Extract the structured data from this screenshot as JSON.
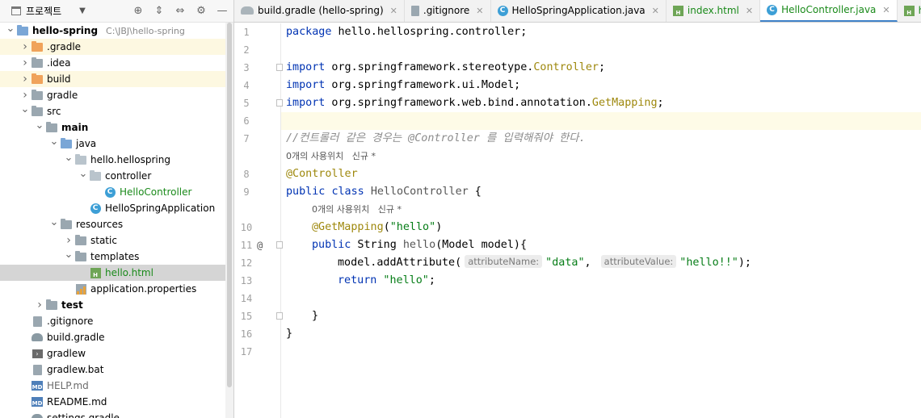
{
  "panel": {
    "title": "프로젝트",
    "tools": [
      "target-icon",
      "expand-all-icon",
      "collapse-all-icon",
      "gear-icon",
      "minimize-icon"
    ]
  },
  "tree": [
    {
      "depth": 0,
      "arrow": "down",
      "icon": "module-folder",
      "label": "hello-spring",
      "bold": true,
      "path": "C:\\JBJ\\hello-spring"
    },
    {
      "depth": 1,
      "arrow": "right",
      "icon": "folder-orange",
      "label": ".gradle",
      "hl": true
    },
    {
      "depth": 1,
      "arrow": "right",
      "icon": "folder",
      "label": ".idea"
    },
    {
      "depth": 1,
      "arrow": "right",
      "icon": "folder-orange",
      "label": "build",
      "hl": true
    },
    {
      "depth": 1,
      "arrow": "right",
      "icon": "folder",
      "label": "gradle"
    },
    {
      "depth": 1,
      "arrow": "down",
      "icon": "folder",
      "label": "src"
    },
    {
      "depth": 2,
      "arrow": "down",
      "icon": "folder",
      "label": "main",
      "bold": true
    },
    {
      "depth": 3,
      "arrow": "down",
      "icon": "folder-blue",
      "label": "java"
    },
    {
      "depth": 4,
      "arrow": "down",
      "icon": "folder-pkg",
      "label": "hello.hellospring"
    },
    {
      "depth": 5,
      "arrow": "down",
      "icon": "folder-pkg",
      "label": "controller"
    },
    {
      "depth": 6,
      "arrow": "",
      "icon": "class",
      "label": "HelloController",
      "green": true
    },
    {
      "depth": 5,
      "arrow": "",
      "icon": "class",
      "label": "HelloSpringApplication"
    },
    {
      "depth": 3,
      "arrow": "down",
      "icon": "folder-res",
      "label": "resources"
    },
    {
      "depth": 4,
      "arrow": "right",
      "icon": "folder",
      "label": "static"
    },
    {
      "depth": 4,
      "arrow": "down",
      "icon": "folder",
      "label": "templates"
    },
    {
      "depth": 5,
      "arrow": "",
      "icon": "html",
      "label": "hello.html",
      "green": true,
      "selected": true
    },
    {
      "depth": 4,
      "arrow": "",
      "icon": "props",
      "label": "application.properties"
    },
    {
      "depth": 2,
      "arrow": "right",
      "icon": "folder",
      "label": "test",
      "bold": true
    },
    {
      "depth": 1,
      "arrow": "",
      "icon": "file",
      "label": ".gitignore"
    },
    {
      "depth": 1,
      "arrow": "",
      "icon": "gradle",
      "label": "build.gradle"
    },
    {
      "depth": 1,
      "arrow": "",
      "icon": "term",
      "label": "gradlew"
    },
    {
      "depth": 1,
      "arrow": "",
      "icon": "file",
      "label": "gradlew.bat"
    },
    {
      "depth": 1,
      "arrow": "",
      "icon": "md",
      "label": "HELP.md",
      "gray": true
    },
    {
      "depth": 1,
      "arrow": "",
      "icon": "md",
      "label": "README.md"
    },
    {
      "depth": 1,
      "arrow": "",
      "icon": "gradle",
      "label": "settings.gradle"
    }
  ],
  "tabs": [
    {
      "label": "build.gradle (hello-spring)",
      "icon": "gradle-icon",
      "active": false,
      "green": false
    },
    {
      "label": ".gitignore",
      "icon": "file-icon",
      "active": false,
      "green": false
    },
    {
      "label": "HelloSpringApplication.java",
      "icon": "class-icon",
      "active": false,
      "green": false
    },
    {
      "label": "index.html",
      "icon": "html-icon",
      "active": false,
      "green": true
    },
    {
      "label": "HelloController.java",
      "icon": "class-icon",
      "active": true,
      "green": true
    },
    {
      "label": "hello.html",
      "icon": "html-icon",
      "active": false,
      "green": true
    }
  ],
  "code": {
    "line1": {
      "kw": "package",
      "rest": " hello.hellospring.controller;"
    },
    "line3": {
      "kw": "import",
      "pkg": " org.springframework.stereotype.",
      "cls": "Controller",
      "end": ";"
    },
    "line4": {
      "kw": "import",
      "rest": " org.springframework.ui.Model;"
    },
    "line5": {
      "kw": "import",
      "pkg": " org.springframework.web.bind.annotation.",
      "cls": "GetMapping",
      "end": ";"
    },
    "line7": "//컨트롤러 같은 경우는 @Controller 를 입력해줘야 한다.",
    "hint_class": "0개의 사용위치   신규 *",
    "line8": "@Controller",
    "line9": {
      "kw1": "public",
      "kw2": "class",
      "name": "HelloController",
      "end": " {"
    },
    "hint_method": "0개의 사용위치   신규 *",
    "line10": {
      "ann": "@GetMapping",
      "open": "(",
      "str": "\"hello\"",
      "close": ")"
    },
    "line11": {
      "kw": "public",
      "type": " String ",
      "name": "hello",
      "rest": "(Model model){"
    },
    "line12": {
      "pre": "model.addAttribute(",
      "ph1": "attributeName:",
      "str1": "\"data\"",
      "comma": ",",
      "ph2": "attributeValue:",
      "str2": "\"hello!!\"",
      "end": ");"
    },
    "line13": {
      "kw": "return",
      "str": " \"hello\"",
      "end": ";"
    },
    "line15": "}",
    "line16": "}"
  },
  "gutter": {
    "numbers": [
      "1",
      "2",
      "3",
      "4",
      "5",
      "6",
      "7",
      "",
      "8",
      "9",
      "",
      "10",
      "11",
      "12",
      "13",
      "14",
      "15",
      "16",
      "17"
    ],
    "line11_marker": "@"
  }
}
